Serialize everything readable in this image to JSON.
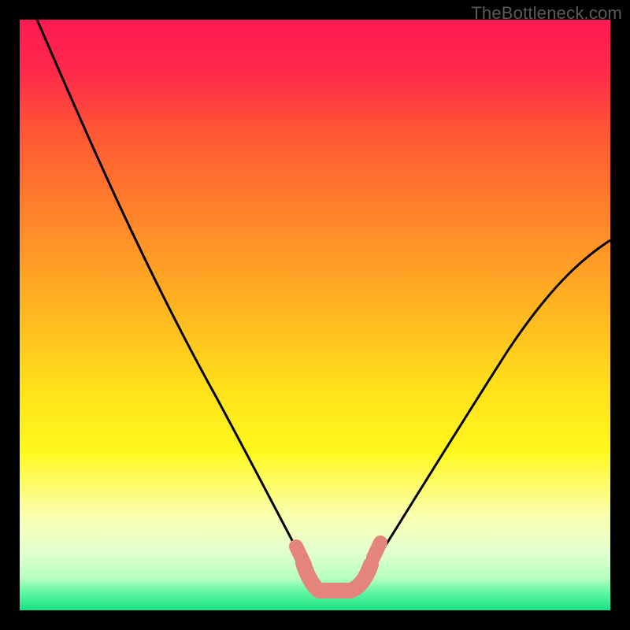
{
  "watermark": "TheBottleneck.com",
  "chart_data": {
    "type": "line",
    "title": "",
    "xlabel": "",
    "ylabel": "",
    "xlim": [
      0,
      100
    ],
    "ylim": [
      0,
      100
    ],
    "legend": false,
    "grid": false,
    "gradient_stops": [
      {
        "pos": 0.0,
        "color": "#ff1a52"
      },
      {
        "pos": 0.08,
        "color": "#ff274b"
      },
      {
        "pos": 0.2,
        "color": "#ff5a33"
      },
      {
        "pos": 0.35,
        "color": "#ff8a2a"
      },
      {
        "pos": 0.5,
        "color": "#ffb820"
      },
      {
        "pos": 0.63,
        "color": "#ffe21a"
      },
      {
        "pos": 0.73,
        "color": "#fff81c"
      },
      {
        "pos": 0.84,
        "color": "#faffb0"
      },
      {
        "pos": 0.9,
        "color": "#e4ffcf"
      },
      {
        "pos": 0.945,
        "color": "#b8ffbf"
      },
      {
        "pos": 0.97,
        "color": "#5ef7a4"
      },
      {
        "pos": 1.0,
        "color": "#19e184"
      }
    ],
    "series": [
      {
        "name": "left-branch",
        "x": [
          3,
          10,
          20,
          30,
          38,
          44,
          48,
          50
        ],
        "y": [
          100,
          84,
          62,
          42,
          26,
          14,
          6,
          3
        ]
      },
      {
        "name": "right-branch",
        "x": [
          58,
          62,
          68,
          76,
          84,
          92,
          100
        ],
        "y": [
          3,
          6,
          14,
          26,
          38,
          50,
          62
        ]
      },
      {
        "name": "valley-marker",
        "x": [
          49,
          50,
          53,
          56,
          58,
          59
        ],
        "y": [
          6,
          3,
          2.5,
          2.5,
          3,
          6
        ]
      }
    ],
    "annotations": []
  }
}
